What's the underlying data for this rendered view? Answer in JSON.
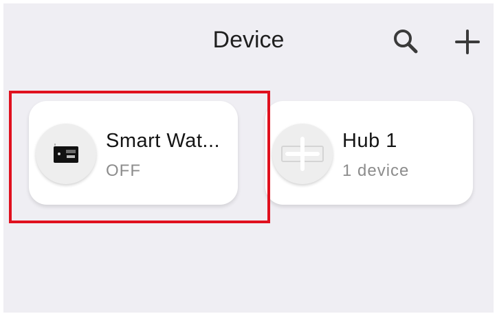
{
  "header": {
    "title": "Device",
    "search_icon": "search-icon",
    "add_icon": "plus-icon"
  },
  "devices": [
    {
      "name": "Smart Wat...",
      "status": "OFF",
      "icon": "smart-water-heater-icon",
      "highlighted": true
    },
    {
      "name": "Hub 1",
      "status": "1 device",
      "icon": "hub-plus-icon"
    }
  ],
  "colors": {
    "background": "#efeef3",
    "card": "#ffffff",
    "highlight": "#e0101e",
    "text_primary": "#141414",
    "text_secondary": "#8c8c8c"
  }
}
